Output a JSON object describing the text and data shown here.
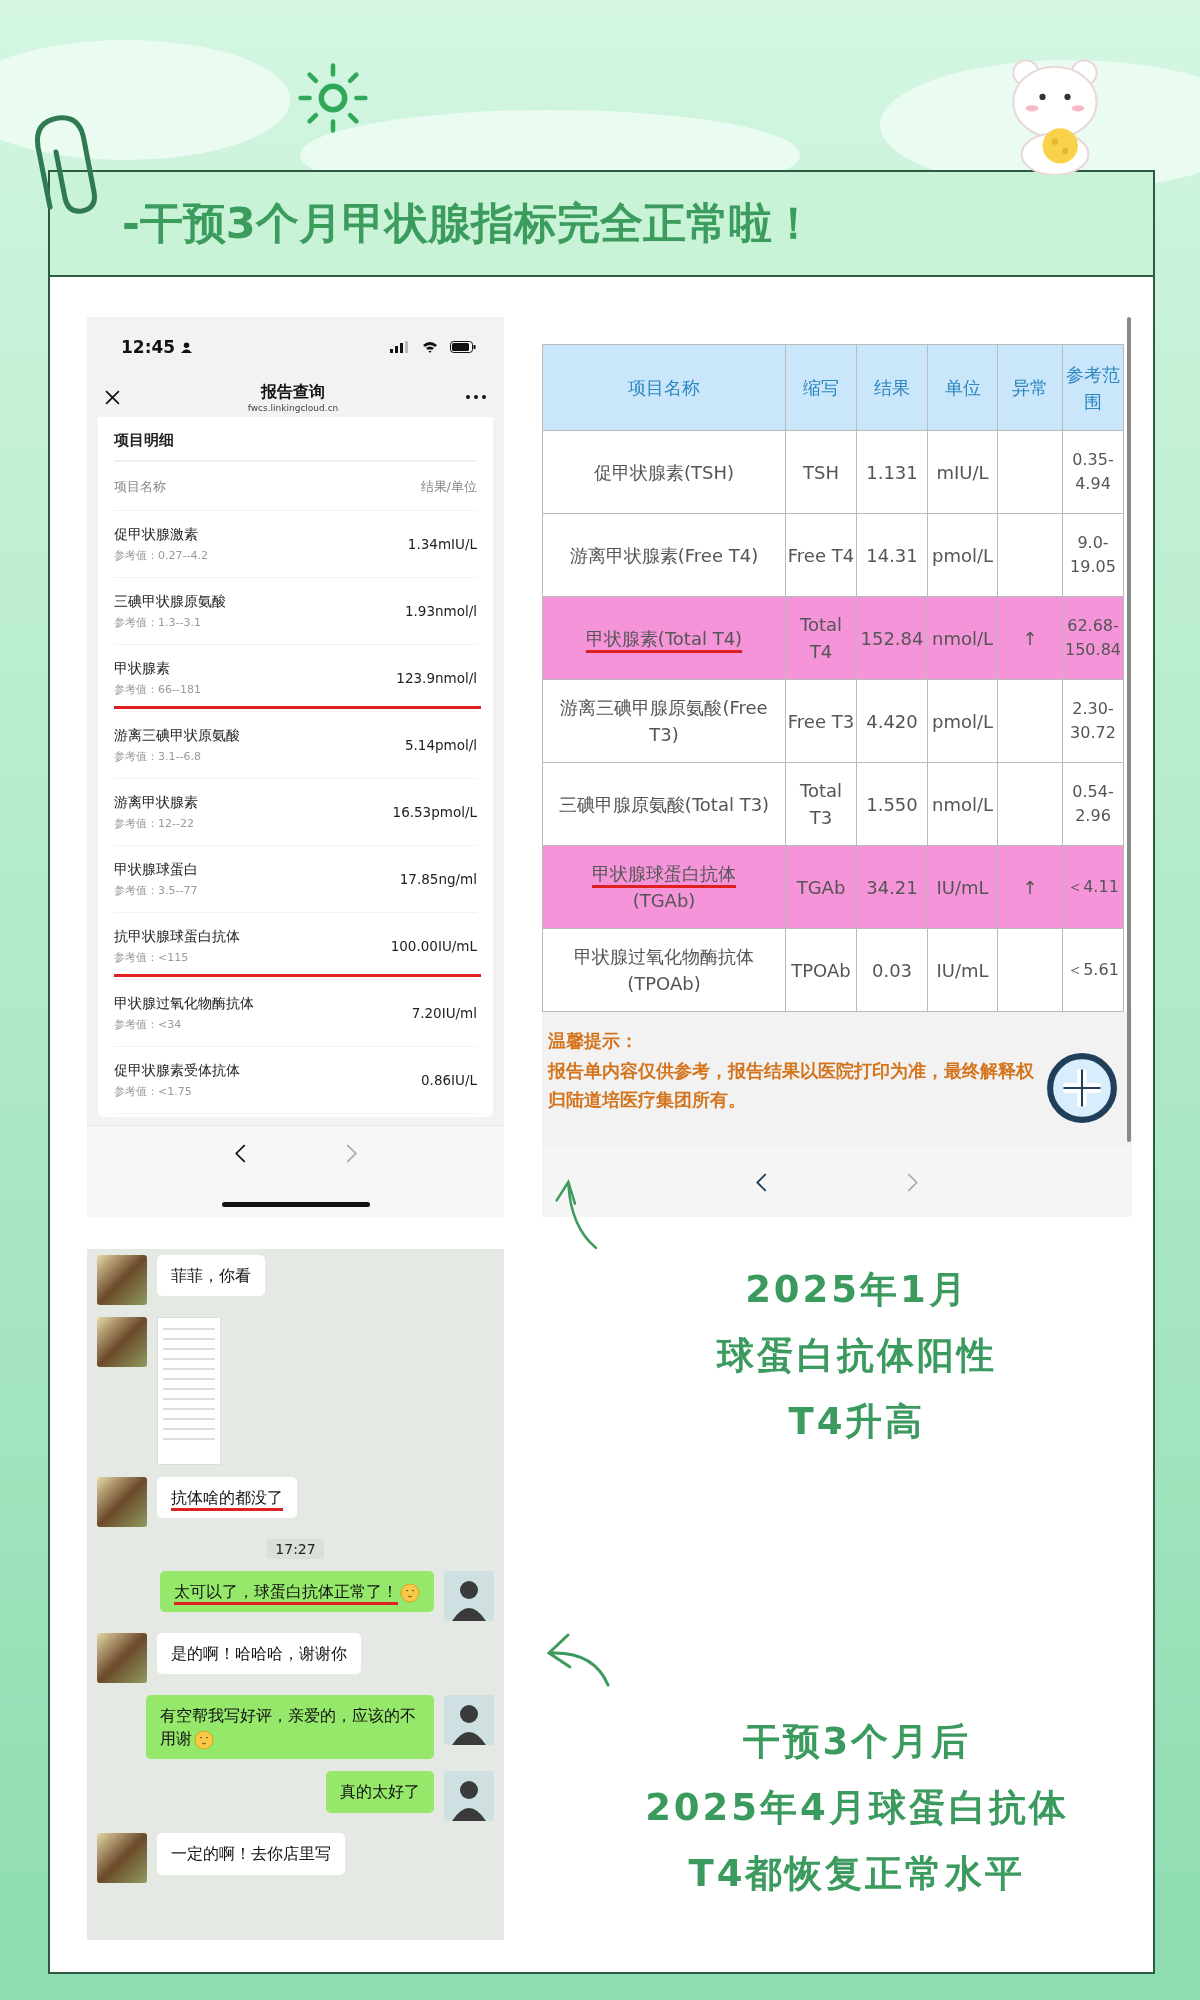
{
  "title": "-干预3个月甲状腺指标完全正常啦！",
  "report_app": {
    "status_bar": {
      "time": "12:45"
    },
    "nav": {
      "title": "报告查询",
      "url": "fwcs.linkingcloud.cn"
    },
    "section_title": "项目明细",
    "columns": [
      "项目名称",
      "结果/单位"
    ],
    "items": [
      {
        "name": "促甲状腺激素",
        "reference": "参考值：0.27--4.2",
        "result": "1.34mIU/L",
        "underlined": false
      },
      {
        "name": "三碘甲状腺原氨酸",
        "reference": "参考值：1.3--3.1",
        "result": "1.93nmol/l",
        "underlined": false
      },
      {
        "name": "甲状腺素",
        "reference": "参考值：66--181",
        "result": "123.9nmol/l",
        "underlined": true
      },
      {
        "name": "游离三碘甲状原氨酸",
        "reference": "参考值：3.1--6.8",
        "result": "5.14pmol/l",
        "underlined": false
      },
      {
        "name": "游离甲状腺素",
        "reference": "参考值：12--22",
        "result": "16.53pmol/L",
        "underlined": false
      },
      {
        "name": "甲状腺球蛋白",
        "reference": "参考值：3.5--77",
        "result": "17.85ng/ml",
        "underlined": false
      },
      {
        "name": "抗甲状腺球蛋白抗体",
        "reference": "参考值：<115",
        "result": "100.00IU/mL",
        "underlined": true
      },
      {
        "name": "甲状腺过氧化物酶抗体",
        "reference": "参考值：<34",
        "result": "7.20IU/ml",
        "underlined": false
      },
      {
        "name": "促甲状腺素受体抗体",
        "reference": "参考值：<1.75",
        "result": "0.86IU/L",
        "underlined": false
      }
    ]
  },
  "report_table": {
    "columns": [
      "项目名称",
      "缩写",
      "结果",
      "单位",
      "异常",
      "参考范围"
    ],
    "rows": [
      {
        "name": "促甲状腺素(TSH)",
        "abbr": "TSH",
        "result": "1.131",
        "unit": "mIU/L",
        "flag": "",
        "range": "0.35-4.94",
        "abnormal": false,
        "underlined": false
      },
      {
        "name": "游离甲状腺素(Free T4)",
        "abbr": "Free T4",
        "result": "14.31",
        "unit": "pmol/L",
        "flag": "",
        "range": "9.0-19.05",
        "abnormal": false,
        "underlined": false
      },
      {
        "name": "甲状腺素(Total T4)",
        "abbr": "Total T4",
        "result": "152.84",
        "unit": "nmol/L",
        "flag": "↑",
        "range": "62.68-150.84",
        "abnormal": true,
        "underlined": true
      },
      {
        "name": "游离三碘甲腺原氨酸(Free T3)",
        "abbr": "Free T3",
        "result": "4.420",
        "unit": "pmol/L",
        "flag": "",
        "range": "2.30-30.72",
        "abnormal": false,
        "underlined": false
      },
      {
        "name": "三碘甲腺原氨酸(Total T3)",
        "abbr": "Total T3",
        "result": "1.550",
        "unit": "nmol/L",
        "flag": "",
        "range": "0.54-2.96",
        "abnormal": false,
        "underlined": false
      },
      {
        "name": "甲状腺球蛋白抗体",
        "name_note": "(TGAb)",
        "abbr": "TGAb",
        "result": "34.21",
        "unit": "IU/mL",
        "flag": "↑",
        "range": "＜4.11",
        "abnormal": true,
        "underlined": true
      },
      {
        "name": "甲状腺过氧化物酶抗体",
        "name_note": "(TPOAb)",
        "abbr": "TPOAb",
        "result": "0.03",
        "unit": "IU/mL",
        "flag": "",
        "range": "＜5.61",
        "abnormal": false,
        "underlined": false
      }
    ],
    "notice": {
      "title": "温馨提示：",
      "text": "报告单内容仅供参考，报告结果以医院打印为准，最终解释权归陆道培医疗集团所有。"
    }
  },
  "captions": [
    [
      "2025年1月",
      "球蛋白抗体阳性",
      "T4升高"
    ],
    [
      "干预3个月后",
      "2025年4月球蛋白抗体",
      "T4都恢复正常水平"
    ]
  ],
  "chat": {
    "messages": [
      {
        "kind": "text",
        "outgoing": false,
        "text": "菲菲，你看",
        "emoji": false,
        "underlined": false
      },
      {
        "kind": "image",
        "outgoing": false
      },
      {
        "kind": "text",
        "outgoing": false,
        "text": "抗体啥的都没了",
        "emoji": false,
        "underlined": true
      },
      {
        "kind": "time",
        "text": "17:27"
      },
      {
        "kind": "text",
        "outgoing": true,
        "text": "太可以了，球蛋白抗体正常了！",
        "emoji": true,
        "underlined": true
      },
      {
        "kind": "text",
        "outgoing": false,
        "text": "是的啊！哈哈哈，谢谢你",
        "emoji": false,
        "underlined": false
      },
      {
        "kind": "text",
        "outgoing": true,
        "text": "有空帮我写好评，亲爱的，应该的不用谢",
        "emoji": true,
        "underlined": false
      },
      {
        "kind": "text",
        "outgoing": true,
        "text": "真的太好了",
        "emoji": false,
        "underlined": false
      },
      {
        "kind": "text",
        "outgoing": false,
        "text": "一定的啊！去你店里写",
        "emoji": false,
        "underlined": false
      }
    ]
  }
}
